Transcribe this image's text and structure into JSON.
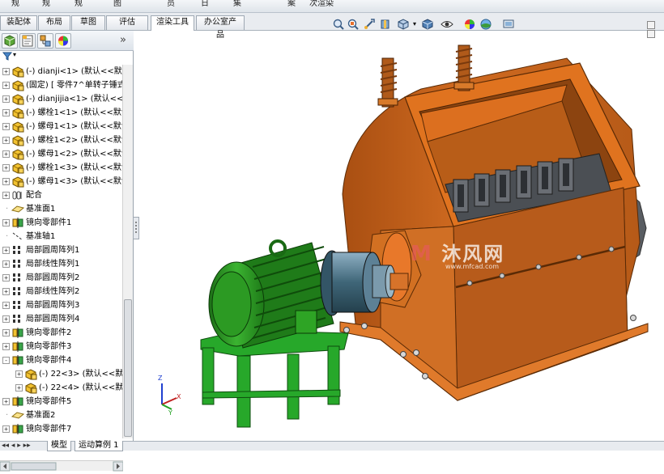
{
  "top_strip_fragments": [
    "规",
    "规",
    "规",
    "图",
    "员",
    "日",
    "集",
    "案",
    "次渲染"
  ],
  "tabs": [
    "装配体",
    "布局",
    "草图",
    "评估",
    "渲染工具",
    "办公室产品"
  ],
  "active_tab": "渲染工具",
  "view_toolbar_icons": [
    "zoom-to-fit-icon",
    "zoom-area-icon",
    "previous-view-icon",
    "section-view-icon",
    "view-orientation-icon",
    "display-style-icon",
    "hide-show-icon",
    "edit-appearance-icon",
    "apply-scene-icon",
    "view-settings-icon"
  ],
  "fm_tabs": [
    "featuremanager-icon",
    "propertymanager-icon",
    "configurationmanager-icon",
    "displaymanager-icon"
  ],
  "tree": [
    {
      "label": "(-) dianji<1> (默认<<默认",
      "icon": "part",
      "exp": "+"
    },
    {
      "label": "(固定) [ 零件7^单转子锤式",
      "icon": "part",
      "exp": "+"
    },
    {
      "label": "(-) dianjijia<1> (默认<<默",
      "icon": "part",
      "exp": "+"
    },
    {
      "label": "(-) 螺栓1<1> (默认<<默认",
      "icon": "part",
      "exp": "+"
    },
    {
      "label": "(-) 螺母1<1> (默认<<默认",
      "icon": "part",
      "exp": "+"
    },
    {
      "label": "(-) 螺栓1<2> (默认<<默认",
      "icon": "part",
      "exp": "+"
    },
    {
      "label": "(-) 螺母1<2> (默认<<默认",
      "icon": "part",
      "exp": "+"
    },
    {
      "label": "(-) 螺栓1<3> (默认<<默认",
      "icon": "part",
      "exp": "+"
    },
    {
      "label": "(-) 螺母1<3> (默认<<默认",
      "icon": "part",
      "exp": "+"
    },
    {
      "label": "配合",
      "icon": "mates",
      "exp": "+"
    },
    {
      "label": "基准面1",
      "icon": "plane",
      "exp": ""
    },
    {
      "label": "镜向零部件1",
      "icon": "mirror",
      "exp": "+"
    },
    {
      "label": "基准轴1",
      "icon": "axis",
      "exp": ""
    },
    {
      "label": "局部圆周阵列1",
      "icon": "pattern",
      "exp": "+"
    },
    {
      "label": "局部线性阵列1",
      "icon": "pattern",
      "exp": "+"
    },
    {
      "label": "局部圆周阵列2",
      "icon": "pattern",
      "exp": "+"
    },
    {
      "label": "局部线性阵列2",
      "icon": "pattern",
      "exp": "+"
    },
    {
      "label": "局部圆周阵列3",
      "icon": "pattern",
      "exp": "+"
    },
    {
      "label": "局部圆周阵列4",
      "icon": "pattern",
      "exp": "+"
    },
    {
      "label": "镜向零部件2",
      "icon": "mirror",
      "exp": "+"
    },
    {
      "label": "镜向零部件3",
      "icon": "mirror",
      "exp": "+"
    },
    {
      "label": "镜向零部件4",
      "icon": "mirror",
      "exp": "-"
    },
    {
      "label": "(-) 22<3> (默认<<默认",
      "icon": "part",
      "exp": "+",
      "indent": 1
    },
    {
      "label": "(-) 22<4> (默认<<默认",
      "icon": "part",
      "exp": "+",
      "indent": 1
    },
    {
      "label": "镜向零部件5",
      "icon": "mirror",
      "exp": "+"
    },
    {
      "label": "基准面2",
      "icon": "plane",
      "exp": ""
    },
    {
      "label": "镜向零部件7",
      "icon": "mirror",
      "exp": "+"
    }
  ],
  "bottom_tabs": [
    "模型",
    "运动算例 1"
  ],
  "watermark": {
    "text": "沐风网",
    "url": "www.mfcad.com"
  },
  "triad": {
    "x": "X",
    "y": "Y",
    "z": "Z"
  },
  "colors": {
    "housing_orange": "#c8661e",
    "frame_orange": "#e0731f",
    "motor_green": "#2f9b27",
    "stand_green": "#27a82a",
    "coupling_blue": "#4b6e80",
    "rotor_gray": "#5a5e63"
  }
}
